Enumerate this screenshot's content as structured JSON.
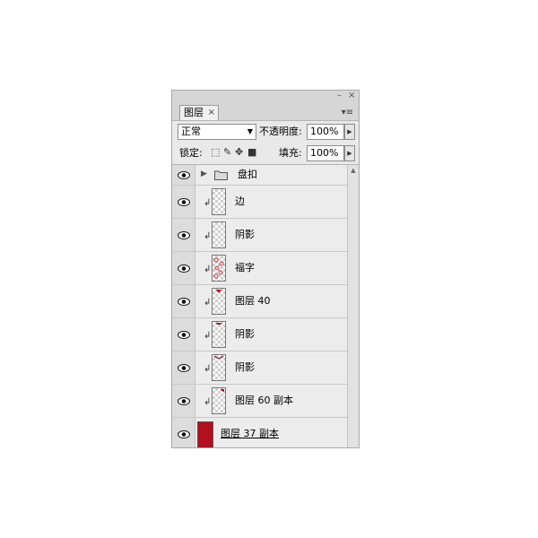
{
  "panel": {
    "tab_label": "图层",
    "tab_close": "×",
    "minimize": "–",
    "close": "×",
    "menu_icon": "▾≡",
    "blend_mode": "正常",
    "opacity_label": "不透明度:",
    "opacity_value": "100%",
    "lock_label": "锁定:",
    "fill_label": "填充:",
    "fill_value": "100%"
  },
  "layers": [
    {
      "name": "盘扣",
      "kind": "group",
      "clipped": false
    },
    {
      "name": "边",
      "kind": "layer",
      "clipped": true
    },
    {
      "name": "阴影",
      "kind": "layer",
      "clipped": true
    },
    {
      "name": "福字",
      "kind": "layer",
      "clipped": true
    },
    {
      "name": "图层 40",
      "kind": "layer",
      "clipped": true
    },
    {
      "name": "阴影",
      "kind": "layer",
      "clipped": true
    },
    {
      "name": "阴影",
      "kind": "layer",
      "clipped": true
    },
    {
      "name": "图层 60 副本",
      "kind": "layer",
      "clipped": true
    },
    {
      "name": "图层 37 副本",
      "kind": "layer",
      "clipped": false
    }
  ],
  "colors": {
    "accent_red": "#b01020",
    "panel_bg": "#d6d6d6",
    "row_bg": "#ececec"
  }
}
